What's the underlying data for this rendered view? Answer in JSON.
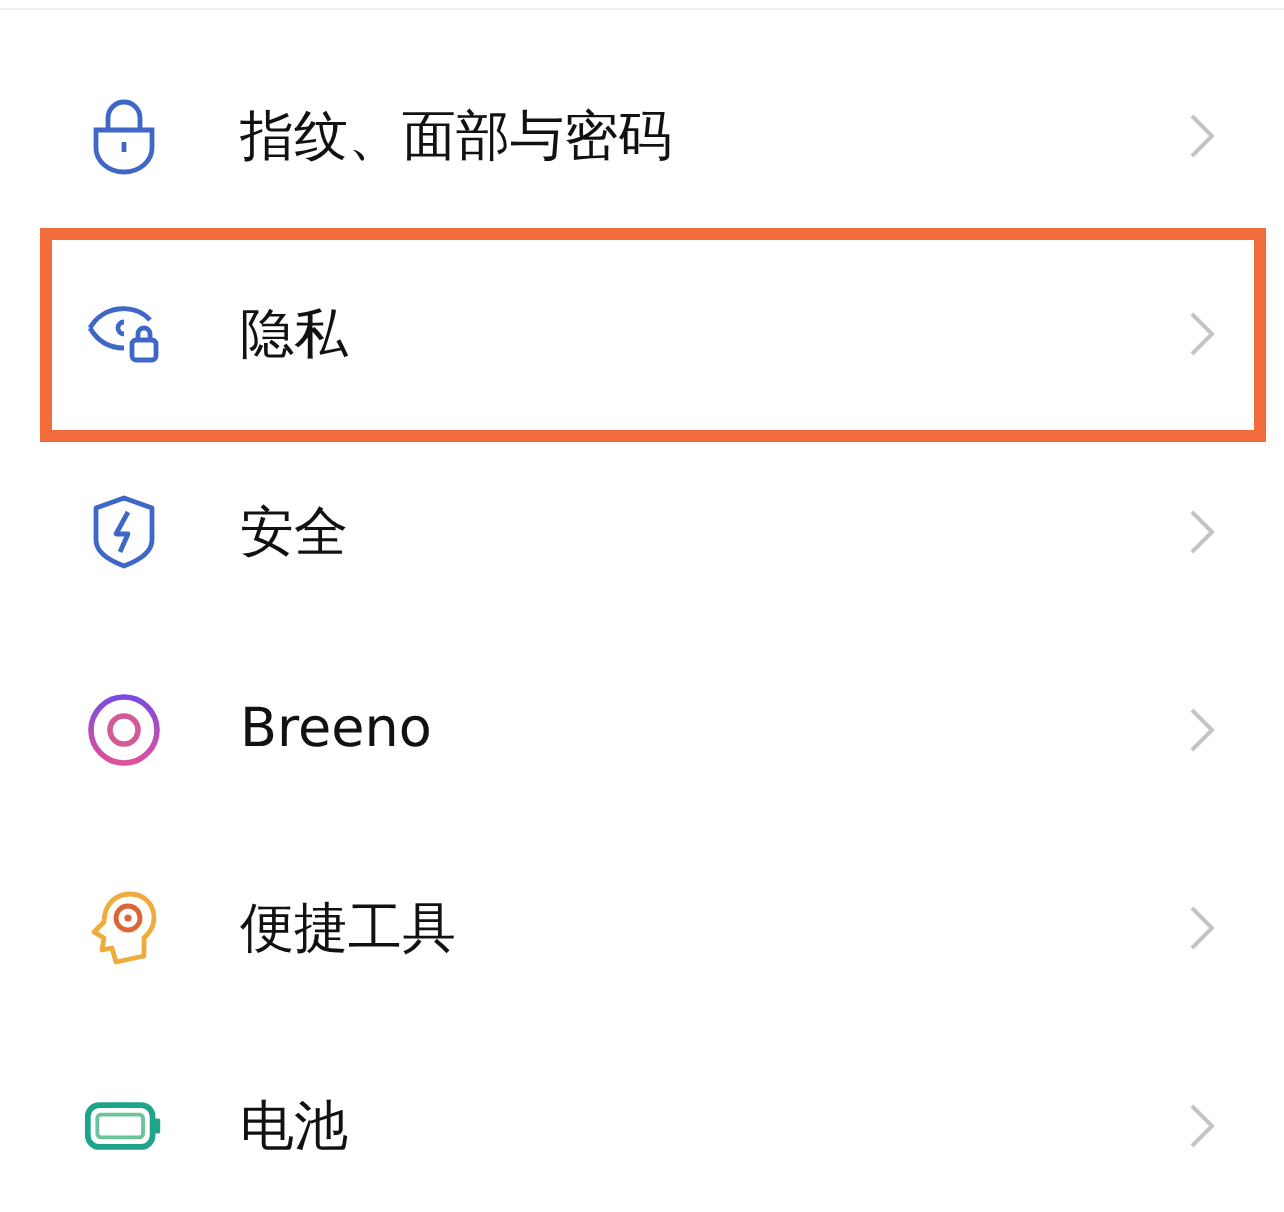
{
  "settings_items": [
    {
      "label": "指纹、面部与密码",
      "highlighted": false
    },
    {
      "label": "隐私",
      "highlighted": true
    },
    {
      "label": "安全",
      "highlighted": false
    },
    {
      "label": "Breeno",
      "highlighted": false
    },
    {
      "label": "便捷工具",
      "highlighted": false
    },
    {
      "label": "电池",
      "highlighted": false
    }
  ]
}
